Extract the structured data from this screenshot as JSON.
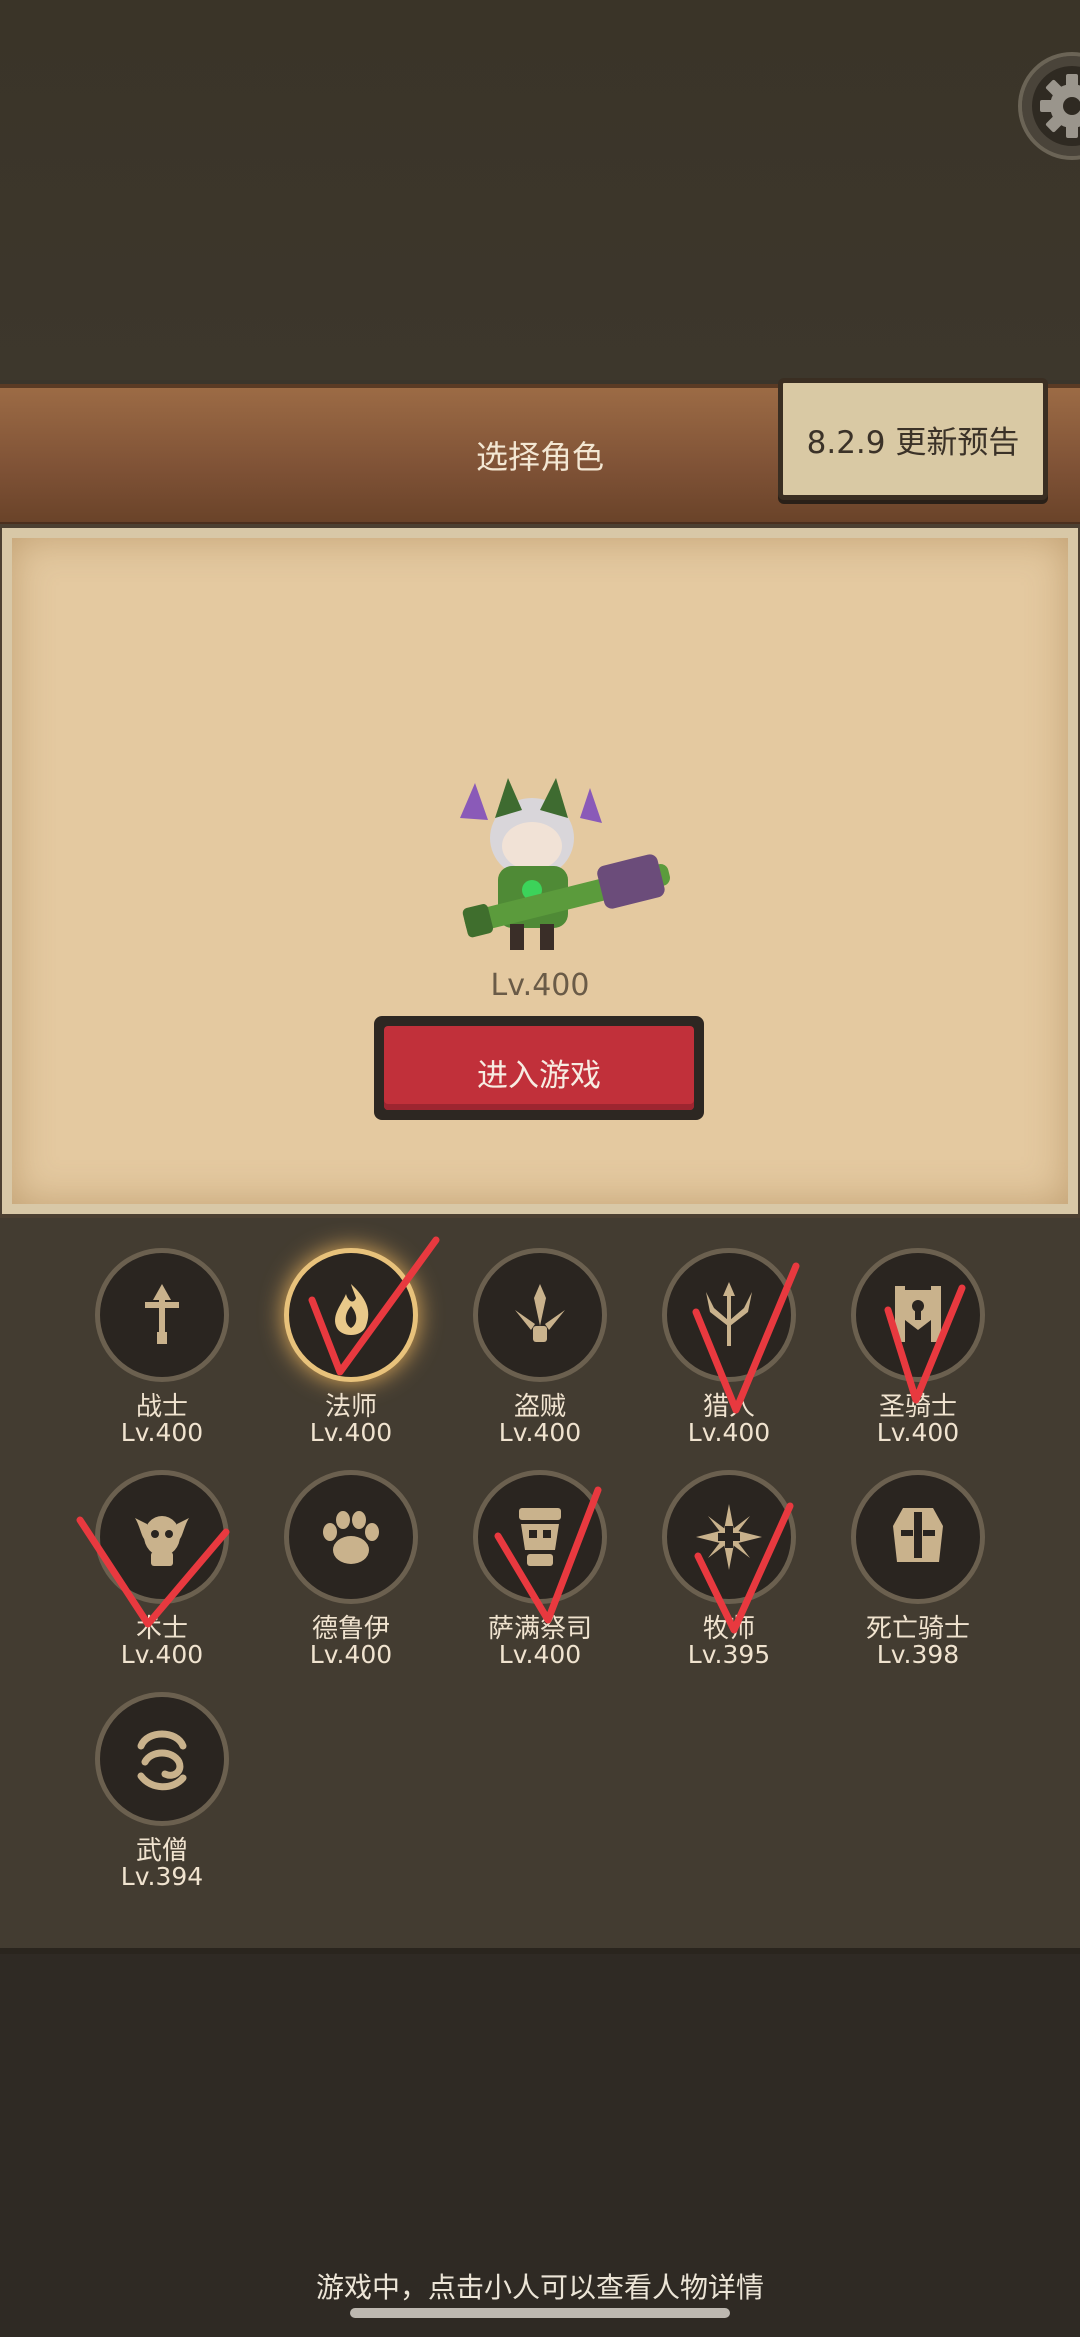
{
  "header": {
    "title": "选择角色",
    "update_label": "8.2.9 更新预告"
  },
  "hero": {
    "level": "Lv.400",
    "enter_label": "进入游戏"
  },
  "classes": [
    {
      "name": "战士",
      "level": "Lv.400",
      "icon": "warrior-sword-icon"
    },
    {
      "name": "法师",
      "level": "Lv.400",
      "icon": "mage-flame-icon",
      "selected": true
    },
    {
      "name": "盗贼",
      "level": "Lv.400",
      "icon": "rogue-daggers-icon"
    },
    {
      "name": "猎人",
      "level": "Lv.400",
      "icon": "hunter-trident-icon"
    },
    {
      "name": "圣骑士",
      "level": "Lv.400",
      "icon": "paladin-banner-icon"
    },
    {
      "name": "术士",
      "level": "Lv.400",
      "icon": "warlock-skull-icon"
    },
    {
      "name": "德鲁伊",
      "level": "Lv.400",
      "icon": "druid-paw-icon"
    },
    {
      "name": "萨满祭司",
      "level": "Lv.400",
      "icon": "shaman-totem-icon"
    },
    {
      "name": "牧师",
      "level": "Lv.395",
      "icon": "priest-star-icon"
    },
    {
      "name": "死亡骑士",
      "level": "Lv.398",
      "icon": "death-knight-helm-icon"
    },
    {
      "name": "武僧",
      "level": "Lv.394",
      "icon": "monk-swirl-icon"
    }
  ],
  "footer": {
    "hint": "游戏中，点击小人可以查看人物详情"
  },
  "colors": {
    "accent_red": "#c1303a",
    "gold": "#e8c27b",
    "check_red": "#e8393f"
  }
}
